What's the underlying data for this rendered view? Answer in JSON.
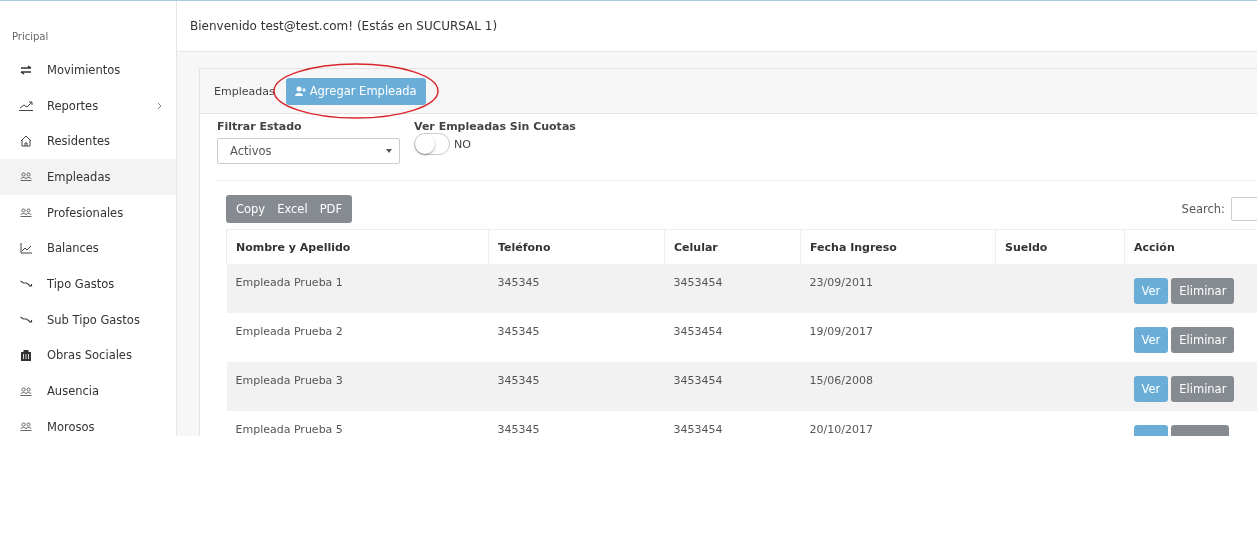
{
  "sidebar": {
    "section": "Pricipal",
    "items": [
      {
        "label": "Movimientos",
        "kind": "arrows",
        "selected": false,
        "submenu": false
      },
      {
        "label": "Reportes",
        "kind": "trend",
        "selected": false,
        "submenu": true
      },
      {
        "label": "Residentes",
        "kind": "home",
        "selected": false,
        "submenu": false
      },
      {
        "label": "Empleadas",
        "kind": "people",
        "selected": true,
        "submenu": false
      },
      {
        "label": "Profesionales",
        "kind": "people",
        "selected": false,
        "submenu": false
      },
      {
        "label": "Balances",
        "kind": "chart",
        "selected": false,
        "submenu": false
      },
      {
        "label": "Tipo Gastos",
        "kind": "down",
        "selected": false,
        "submenu": false
      },
      {
        "label": "Sub Tipo Gastos",
        "kind": "down",
        "selected": false,
        "submenu": false
      },
      {
        "label": "Obras Sociales",
        "kind": "building",
        "selected": false,
        "submenu": false
      },
      {
        "label": "Ausencia",
        "kind": "people",
        "selected": false,
        "submenu": false
      },
      {
        "label": "Morosos",
        "kind": "people",
        "selected": false,
        "submenu": false
      }
    ]
  },
  "header": {
    "welcome": "Bienvenido test@test.com! (Estás en SUCURSAL 1)"
  },
  "panel": {
    "title": "Empleadas",
    "add_button": "Agregar Empleada",
    "add_button_highlighted": true
  },
  "filters": {
    "estado_label": "Filtrar Estado",
    "estado_value": "Activos",
    "toggle_label": "Ver Empleadas Sin Cuotas",
    "toggle_on": false,
    "toggle_text": "NO"
  },
  "export_buttons": [
    "Copy",
    "Excel",
    "PDF"
  ],
  "search": {
    "label": "Search:"
  },
  "table": {
    "columns": [
      "Nombre y Apellido",
      "Teléfono",
      "Celular",
      "Fecha Ingreso",
      "Sueldo",
      "Acción"
    ],
    "rows": [
      {
        "cells": [
          "Empleada Prueba 1",
          "345345",
          "3453454",
          "23/09/2011",
          ""
        ],
        "actions": [
          {
            "kind": "view",
            "label": "Ver"
          },
          {
            "kind": "delete",
            "label": "Eliminar"
          }
        ]
      },
      {
        "cells": [
          "Empleada Prueba 2",
          "345345",
          "3453454",
          "19/09/2017",
          ""
        ],
        "actions": [
          {
            "kind": "view",
            "label": "Ver"
          },
          {
            "kind": "delete",
            "label": "Eliminar"
          }
        ]
      },
      {
        "cells": [
          "Empleada Prueba 3",
          "345345",
          "3453454",
          "15/06/2008",
          ""
        ],
        "actions": [
          {
            "kind": "view",
            "label": "Ver"
          },
          {
            "kind": "delete",
            "label": "Eliminar"
          }
        ]
      },
      {
        "cells": [
          "Empleada Prueba 5",
          "345345",
          "3453454",
          "20/10/2017",
          ""
        ],
        "actions": [
          {
            "kind": "view"
          },
          {
            "kind": "delete"
          }
        ]
      }
    ]
  }
}
